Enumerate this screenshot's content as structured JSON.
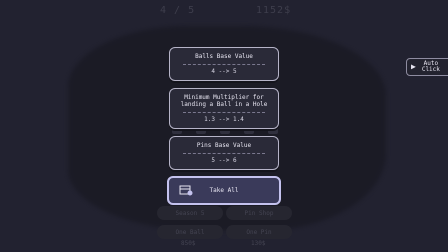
{
  "hud": {
    "round": "4 / 5",
    "money": "1152$"
  },
  "auto_click": {
    "line1": "Auto",
    "line2": "Click"
  },
  "upgrades": [
    {
      "title": "Balls Base Value",
      "change": "4 --> 5"
    },
    {
      "title": "Minimum Multiplier for landing a Ball in a Hole",
      "change": "1.3 --> 1.4"
    },
    {
      "title": "Pins Base Value",
      "change": "5 --> 6"
    }
  ],
  "take_all": {
    "label": "Take All"
  },
  "background_buttons": {
    "season": "Season 5",
    "pin_shop": "Pin Shop",
    "one_ball": {
      "label": "One Ball",
      "price": "850$"
    },
    "one_pin": {
      "label": "One Pin",
      "price": "130$"
    }
  },
  "colors": {
    "accent": "#c4c2ee",
    "background": "#222230",
    "card": "#2a2a38"
  }
}
